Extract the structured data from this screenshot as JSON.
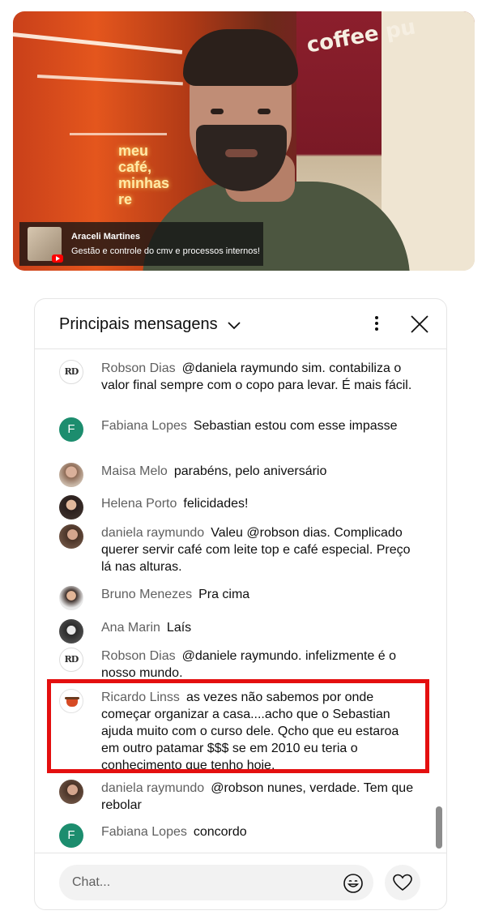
{
  "video": {
    "overlay": {
      "name": "Araceli Martines",
      "description": "Gestão e controle do cmv e processos internos!"
    },
    "scene_text": {
      "neon_sign": [
        "meu",
        "café,",
        "minhas",
        "re"
      ],
      "brand": "coffee pu"
    }
  },
  "chat": {
    "title": "Principais mensagens",
    "input_placeholder": "Chat...",
    "messages": [
      {
        "author": "Robson Dias",
        "text": "@daniela raymundo sim. contabiliza o valor final sempre com o copo para levar. É mais fácil.",
        "avatar": "logo-icon"
      },
      {
        "author": "Fabiana Lopes",
        "text": "Sebastian estou com esse impasse",
        "avatar": "F"
      },
      {
        "author": "Maisa Melo",
        "text": "parabéns, pelo aniversário",
        "avatar": "photo"
      },
      {
        "author": "Helena Porto",
        "text": "felicidades!",
        "avatar": "photo"
      },
      {
        "author": "daniela raymundo",
        "text": "Valeu @robson dias. Complicado querer servir café com leite top e café especial. Preço lá nas alturas.",
        "avatar": "photo"
      },
      {
        "author": "Bruno Menezes",
        "text": "Pra cima",
        "avatar": "photo"
      },
      {
        "author": "Ana Marin",
        "text": "Laís",
        "avatar": "photo"
      },
      {
        "author": "Robson Dias",
        "text": "@daniele raymundo. infelizmente é o nosso mundo.",
        "avatar": "logo-icon"
      },
      {
        "author": "Ricardo Linss",
        "text": "as vezes não sabemos por onde começar organizar a casa....acho que o Sebastian ajuda muito com o curso dele. Qcho que eu estaroa em outro patamar $$$ se em 2010 eu teria o conhecimento que tenho hoje.",
        "avatar": "cup-icon",
        "highlighted": true
      },
      {
        "author": "daniela raymundo",
        "text": "@robson nunes, verdade. Tem que rebolar",
        "avatar": "photo"
      },
      {
        "author": "Fabiana Lopes",
        "text": "concordo",
        "avatar": "F"
      }
    ]
  },
  "icons": {
    "dropdown": "chevron-down-icon",
    "more": "more-vert-icon",
    "close": "close-icon",
    "emoji": "emoji-icon",
    "like": "heart-icon"
  },
  "colors": {
    "highlight_border": "#e40f0f",
    "author_text": "#606060",
    "fabiana_avatar": "#1c8d6e"
  }
}
